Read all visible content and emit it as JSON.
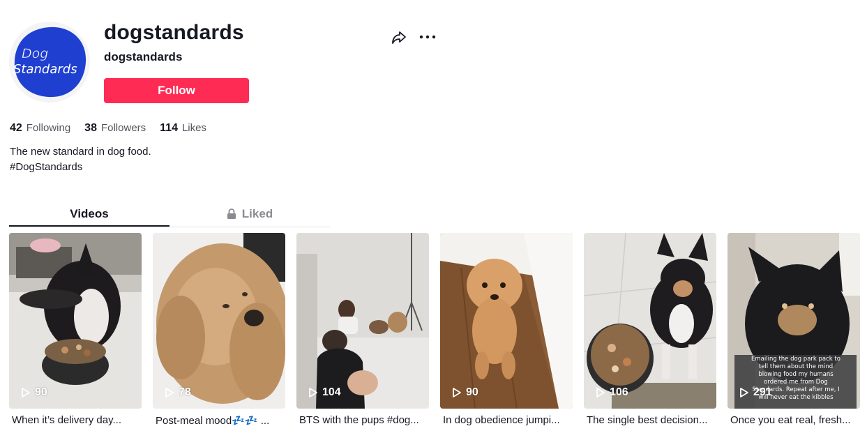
{
  "profile": {
    "unique_id": "dogstandards",
    "nickname": "dogstandards",
    "avatar_text_line1": "Dog",
    "avatar_text_line2": "Standards",
    "follow_label": "Follow",
    "bio_line1": "The new standard in dog food.",
    "bio_line2": "#DogStandards"
  },
  "stats": {
    "following_count": "42",
    "following_label": "Following",
    "followers_count": "38",
    "followers_label": "Followers",
    "likes_count": "114",
    "likes_label": "Likes"
  },
  "icons": {
    "share": "share-icon",
    "more": "more-icon",
    "lock": "lock-icon",
    "play": "play-icon"
  },
  "tabs": {
    "videos": "Videos",
    "liked": "Liked"
  },
  "colors": {
    "follow": "#fe2c55",
    "avatar_blue": "#1f3fd1",
    "text": "#161823"
  },
  "videos": [
    {
      "views": "90",
      "caption": "When it’s delivery day..."
    },
    {
      "views": "78",
      "caption": "Post-meal mood💤💤 ..."
    },
    {
      "views": "104",
      "caption": "BTS with the pups #dog..."
    },
    {
      "views": "90",
      "caption": "In dog obedience jumpi..."
    },
    {
      "views": "106",
      "caption": "The single best decision..."
    },
    {
      "views": "291",
      "caption": "Once you eat real, fresh..."
    }
  ],
  "thumbnail_overlay_text": {
    "video_6": "Emailing the dog park pack to tell them about the mind blowing food my humans ordered me from Dog Standards. Repeat after me, I will never eat the kibbles"
  }
}
